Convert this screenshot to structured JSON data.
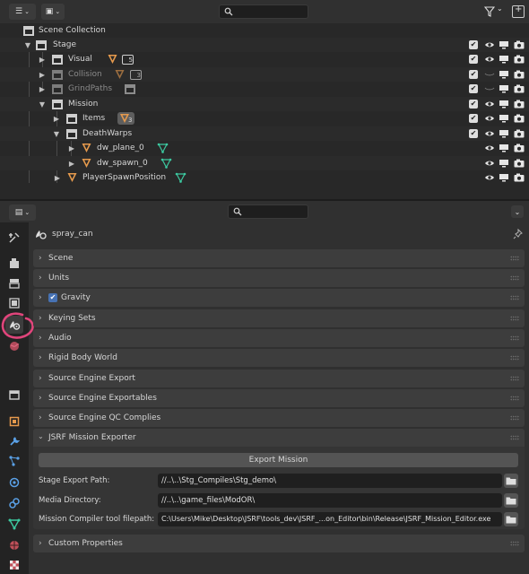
{
  "outliner": {
    "root_label": "Scene Collection",
    "rows": [
      {
        "label": "Stage",
        "count": ""
      },
      {
        "label": "Visual",
        "count": "5"
      },
      {
        "label": "Collision",
        "count": "3"
      },
      {
        "label": "GrindPaths",
        "count": ""
      },
      {
        "label": "Mission",
        "count": ""
      },
      {
        "label": "Items",
        "count": "3"
      },
      {
        "label": "DeathWarps",
        "count": ""
      },
      {
        "label": "dw_plane_0",
        "count": ""
      },
      {
        "label": "dw_spawn_0",
        "count": ""
      },
      {
        "label": "PlayerSpawnPosition",
        "count": ""
      }
    ]
  },
  "properties": {
    "context_label": "spray_can",
    "panels": {
      "scene": "Scene",
      "units": "Units",
      "gravity": "Gravity",
      "keying_sets": "Keying Sets",
      "audio": "Audio",
      "rigid_body_world": "Rigid Body World",
      "source_engine_export": "Source Engine Export",
      "source_engine_exportables": "Source Engine Exportables",
      "source_engine_qc": "Source Engine QC Complies",
      "jsrf_mission_exporter": "JSRF Mission Exporter",
      "custom_properties": "Custom Properties"
    },
    "export_mission_button": "Export Mission",
    "fields": {
      "stage_export_label": "Stage Export Path:",
      "stage_export_value": "//..\\..\\Stg_Compiles\\Stg_demo\\",
      "media_dir_label": "Media Directory:",
      "media_dir_value": "//..\\..\\game_files\\ModOR\\",
      "compiler_label": "Mission Compiler tool filepath:",
      "compiler_value": "C:\\Users\\Mike\\Desktop\\JSRF\\tools_dev\\JSRF_...on_Editor\\bin\\Release\\JSRF_Mission_Editor.exe"
    }
  },
  "colors": {
    "accent_blue": "#4772b3",
    "object_orange": "#e69a4d",
    "mesh_teal": "#3cc9a0",
    "annotation_circle": "#e0457b"
  }
}
